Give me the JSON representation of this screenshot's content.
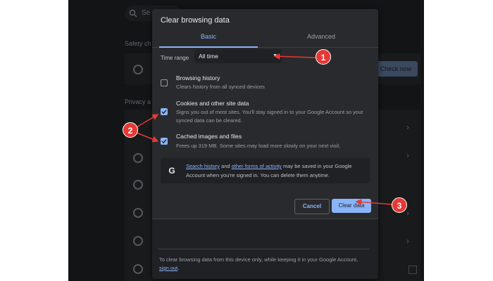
{
  "background": {
    "search_fragment": "Se",
    "section_safety": "Safety ch",
    "section_privacy": "Privacy a",
    "check_now_label": "Check now"
  },
  "dialog": {
    "title": "Clear browsing data",
    "tabs": [
      {
        "label": "Basic",
        "selected": true
      },
      {
        "label": "Advanced",
        "selected": false
      }
    ],
    "time_range": {
      "label": "Time range",
      "value": "All time"
    },
    "options": [
      {
        "title": "Browsing history",
        "desc": "Clears history from all synced devices",
        "checked": false
      },
      {
        "title": "Cookies and other site data",
        "desc": "Signs you out of most sites. You'll stay signed in to your Google Account so your synced data can be cleared.",
        "checked": true
      },
      {
        "title": "Cached images and files",
        "desc": "Frees up 319 MB. Some sites may load more slowly on your next visit.",
        "checked": true
      }
    ],
    "info": {
      "link1": "Search history",
      "mid": " and ",
      "link2": "other forms of activity",
      "rest": " may be saved in your Google Account when you're signed in. You can delete them anytime."
    },
    "buttons": {
      "cancel": "Cancel",
      "clear": "Clear data"
    },
    "footer": {
      "text": "To clear browsing data from this device only, while keeping it in your Google Account, ",
      "link": "sign out",
      "end": "."
    }
  },
  "annotations": {
    "badges": [
      "1",
      "2",
      "3"
    ],
    "color": "#e53935"
  },
  "colors": {
    "accent": "#8ab4f8",
    "dialog_bg": "#292a2d",
    "page_bg": "#202124"
  }
}
